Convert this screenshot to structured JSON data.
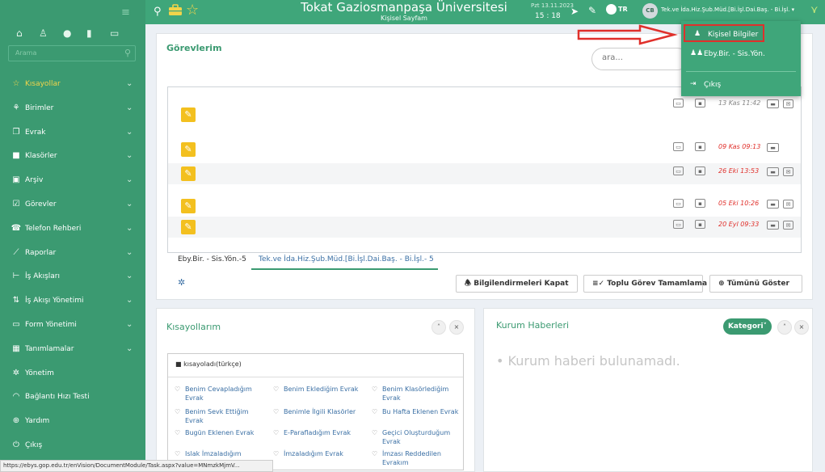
{
  "header": {
    "title": "Tokat Gaziosmanpaşa Üniversitesi",
    "subtitle": "Kişisel Sayfam",
    "date": "Pzt 13.11.2023",
    "time": "15 : 18",
    "language": "TR",
    "avatar_initials": "CB",
    "user": "Tek.ve İda.Hiz.Şub.Müd.[Bi.İşl.Dai.Baş. - Bi.İşl. ▾"
  },
  "user_menu": {
    "items": [
      {
        "label": "Kişisel Bilgiler",
        "icon": "user-icon"
      },
      {
        "label": "Eby.Bir. - Sis.Yön.",
        "icon": "users-icon"
      },
      {
        "label": "Çıkış",
        "icon": "logout-icon"
      }
    ]
  },
  "sidebar": {
    "search_placeholder": "Arama",
    "items": [
      {
        "label": "Kısayollar",
        "icon": "☆",
        "active": true
      },
      {
        "label": "Birimler",
        "icon": "⚘"
      },
      {
        "label": "Evrak",
        "icon": "❐"
      },
      {
        "label": "Klasörler",
        "icon": "■"
      },
      {
        "label": "Arşiv",
        "icon": "▣"
      },
      {
        "label": "Görevler",
        "icon": "☑"
      },
      {
        "label": "Telefon Rehberi",
        "icon": "☎"
      },
      {
        "label": "Raporlar",
        "icon": "⟋"
      },
      {
        "label": "İş Akışları",
        "icon": "⊢"
      },
      {
        "label": "İş Akışı Yönetimi",
        "icon": "⇅"
      },
      {
        "label": "Form Yönetimi",
        "icon": "▭"
      },
      {
        "label": "Tanımlamalar",
        "icon": "▦"
      },
      {
        "label": "Yönetim",
        "icon": "✲"
      },
      {
        "label": "Bağlantı Hızı Testi",
        "icon": "◠"
      },
      {
        "label": "Yardım",
        "icon": "⊕"
      },
      {
        "label": "Çıkış",
        "icon": "⏻"
      }
    ]
  },
  "gorevlerim": {
    "title": "Görevlerim",
    "search_placeholder": "ara...",
    "rows": [
      {
        "date": "13 Kas 11:42"
      },
      {
        "date": "09 Kas 09:13"
      },
      {
        "date": "26 Eki 13:53"
      },
      {
        "date": "05 Eki 10:26"
      },
      {
        "date": "20 Eyl 09:33"
      }
    ],
    "tabs": [
      "Eby.Bir. - Sis.Yön.-5",
      "Tek.ve İda.Hiz.Şub.Müd.[Bi.İşl.Dai.Baş. - Bi.İşl.- 5"
    ],
    "buttons": {
      "close_info": "Bilgilendirmeleri Kapat",
      "bulk_complete": "Toplu Görev Tamamlama",
      "show_all": "Tümünü Göster"
    }
  },
  "kisayollarim": {
    "title": "Kısayollarım",
    "list_header": "kısayoladı(türkçe)",
    "items": [
      "Benim Cevapladığım Evrak",
      "Benim Eklediğim Evrak",
      "Benim Klasörlediğim Evrak",
      "Benim Sevk Ettiğim Evrak",
      "Benimle İlgili Klasörler",
      "Bu Hafta Eklenen Evrak",
      "Bugün Eklenen Evrak",
      "E-Parafladığım Evrak",
      "Geçici Oluşturduğum Evrak",
      "Islak İmzaladığım",
      "İmzaladığım Evrak",
      "İmzası Reddedilen Evrakım"
    ]
  },
  "kurum_haberleri": {
    "title": "Kurum Haberleri",
    "category_button": "Kategori",
    "empty_text": "• Kurum haberi bulunamadı."
  },
  "status_bar": {
    "url": "https://ebys.gop.edu.tr/enVision/DocumentModule/Task.aspx?value=MNmzkMjmV..."
  },
  "colors": {
    "primary": "#3fa67a",
    "sidebar": "#3b9a71",
    "date_red": "#e0302b",
    "task_yellow": "#f3c01f"
  }
}
